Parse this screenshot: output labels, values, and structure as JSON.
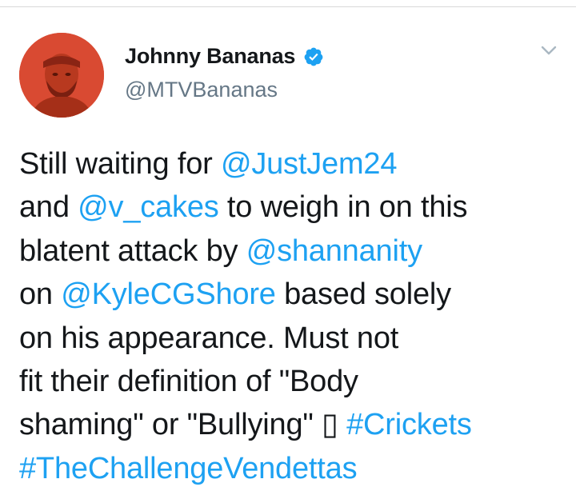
{
  "user": {
    "display_name": "Johnny Bananas",
    "handle": "@MTVBananas",
    "verified": true,
    "avatar_bg": "#d94a32"
  },
  "tweet": {
    "lines": [
      [
        {
          "t": "Still waiting for "
        },
        {
          "t": "@JustJem24",
          "link": true
        }
      ],
      [
        {
          "t": "and "
        },
        {
          "t": "@v_cakes",
          "link": true
        },
        {
          "t": " to weigh in on this"
        }
      ],
      [
        {
          "t": "blatent attack by "
        },
        {
          "t": "@shannanity",
          "link": true
        }
      ],
      [
        {
          "t": "on "
        },
        {
          "t": "@KyleCGShore",
          "link": true
        },
        {
          "t": " based solely"
        }
      ],
      [
        {
          "t": "on his appearance. Must not"
        }
      ],
      [
        {
          "t": "fit their definition of \"Body"
        }
      ],
      [
        {
          "t": "shaming\" or \"Bullying\" ▯ "
        },
        {
          "t": "#Crickets",
          "link": true
        }
      ],
      [
        {
          "t": "#TheChallengeVendettas",
          "link": true
        }
      ]
    ]
  },
  "icons": {
    "verified": "verified-badge-icon",
    "caret": "chevron-down-icon"
  },
  "colors": {
    "link": "#1da1f2",
    "text": "#14171a",
    "secondary": "#657786"
  }
}
